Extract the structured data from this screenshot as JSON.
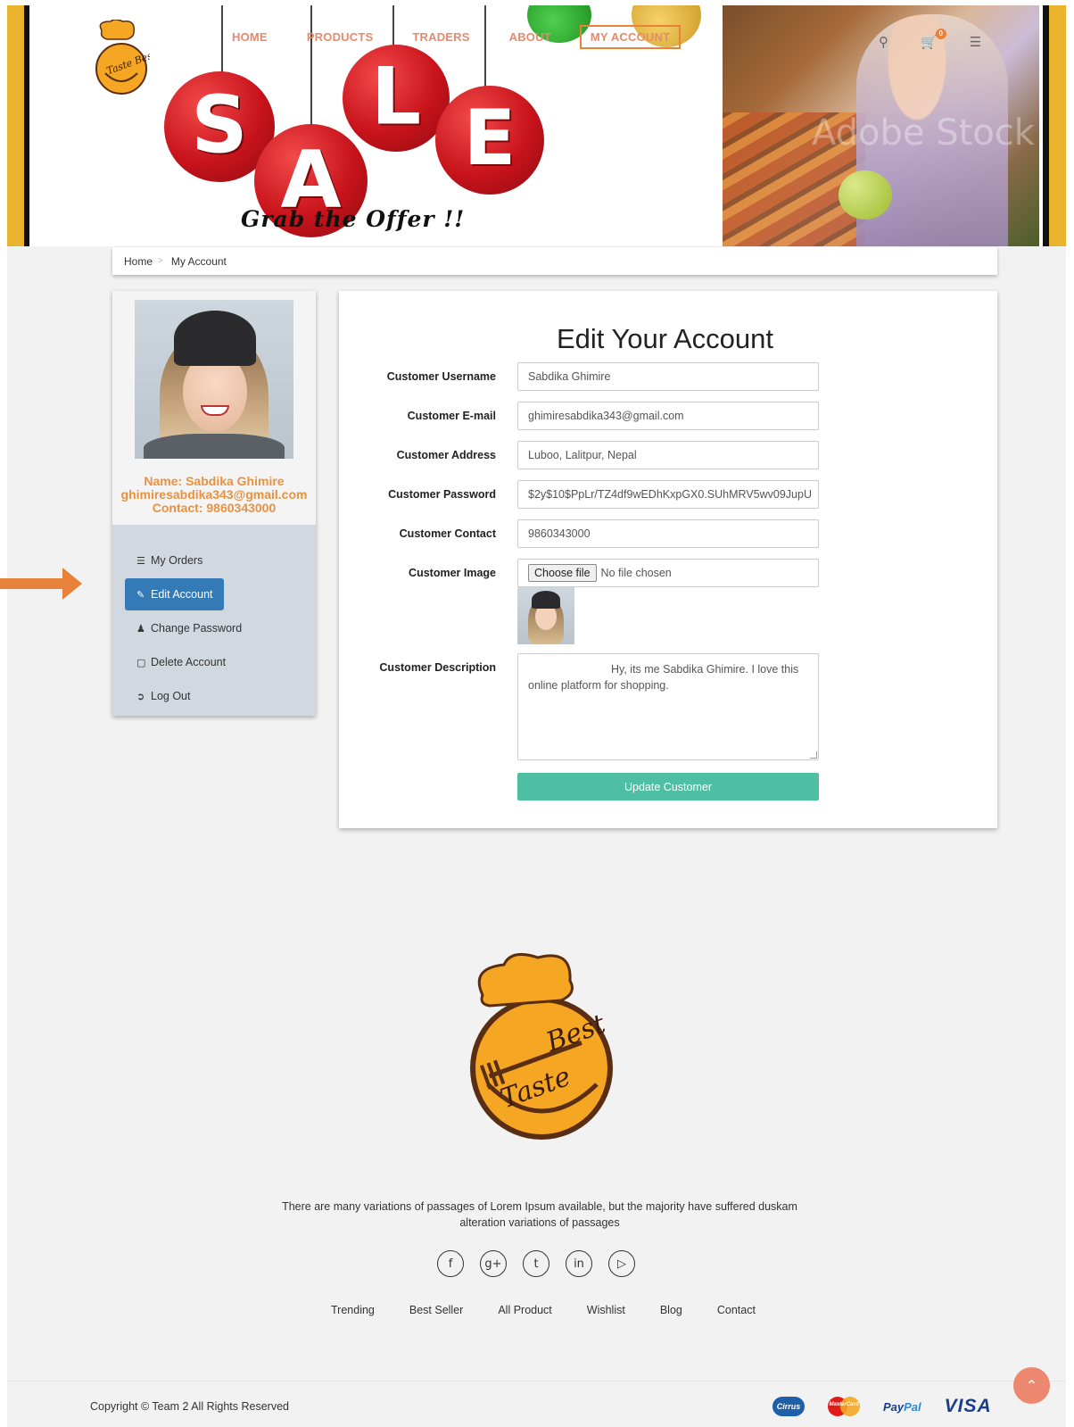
{
  "nav": {
    "items": [
      {
        "label": "HOME",
        "active": false
      },
      {
        "label": "PRODUCTS",
        "active": false
      },
      {
        "label": "TRADERS",
        "active": false
      },
      {
        "label": "ABOUT",
        "active": false
      },
      {
        "label": "MY ACCOUNT",
        "active": true
      }
    ],
    "cart_count": "0"
  },
  "banner": {
    "letters": [
      "S",
      "A",
      "L",
      "E"
    ],
    "tagline": "Grab the Offer !!",
    "watermark": "Adobe Stock"
  },
  "breadcrumb": {
    "home": "Home",
    "current": "My Account"
  },
  "profile": {
    "name": "Name: Sabdika Ghimire",
    "email": "ghimiresabdika343@gmail.com",
    "contact": "Contact: 9860343000"
  },
  "sidebar": {
    "items": [
      {
        "label": "My Orders",
        "icon": "list-icon"
      },
      {
        "label": "Edit Account",
        "icon": "pencil-icon"
      },
      {
        "label": "Change Password",
        "icon": "user-icon"
      },
      {
        "label": "Delete Account",
        "icon": "trash-icon"
      },
      {
        "label": "Log Out",
        "icon": "logout-icon"
      }
    ]
  },
  "form": {
    "title": "Edit Your Account",
    "username_label": "Customer Username",
    "username_value": "Sabdika Ghimire",
    "email_label": "Customer E-mail",
    "email_value": "ghimiresabdika343@gmail.com",
    "address_label": "Customer Address",
    "address_value": "Luboo, Lalitpur, Nepal",
    "password_label": "Customer Password",
    "password_value": "$2y$10$PpLr/TZ4df9wEDhKxpGX0.SUhMRV5wv09JupU",
    "contact_label": "Customer Contact",
    "contact_value": "9860343000",
    "image_label": "Customer Image",
    "file_button": "Choose file",
    "file_status": "No file chosen",
    "description_label": "Customer Description",
    "description_value": "Hy, its me Sabdika  Ghimire. I love this online platform for shopping.",
    "submit_label": "Update Customer"
  },
  "footer": {
    "text": "There are many variations of passages of Lorem Ipsum available, but the majority have suffered duskam alteration variations of passages",
    "links": [
      "Trending",
      "Best Seller",
      "All Product",
      "Wishlist",
      "Blog",
      "Contact"
    ],
    "copyright": "Copyright © Team 2 All Rights Reserved",
    "payments": {
      "cirrus": "Cirrus",
      "mastercard": "MasterCard",
      "paypal_a": "Pay",
      "paypal_b": "Pal",
      "visa": "VISA"
    }
  },
  "colors": {
    "accent": "#e8813a",
    "nav_text": "#e58a6e",
    "active_menu": "#337ab7",
    "submit": "#4fbfa4",
    "banner_bar": "#e9b42b"
  }
}
